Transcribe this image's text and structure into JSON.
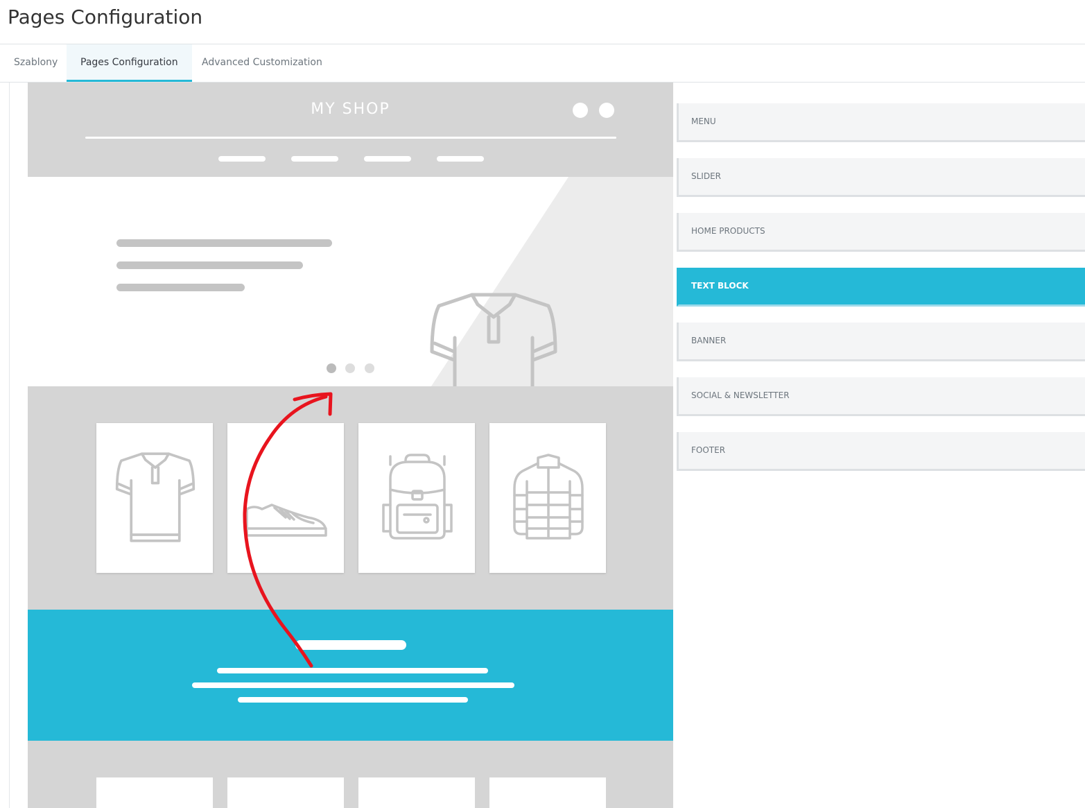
{
  "page": {
    "title": "Pages Configuration"
  },
  "tabs": [
    {
      "label": "Szablony",
      "active": false
    },
    {
      "label": "Pages Configuration",
      "active": true
    },
    {
      "label": "Advanced Customization",
      "active": false
    }
  ],
  "preview": {
    "shop_name": "MY SHOP",
    "slider": {
      "active_dot": 0,
      "dot_count": 3
    },
    "products": [
      "polo-shirt",
      "sneaker",
      "backpack",
      "jacket"
    ]
  },
  "sections": [
    {
      "label": "MENU",
      "active": false
    },
    {
      "label": "SLIDER",
      "active": false
    },
    {
      "label": "HOME PRODUCTS",
      "active": false
    },
    {
      "label": "TEXT BLOCK",
      "active": true
    },
    {
      "label": "BANNER",
      "active": false
    },
    {
      "label": "SOCIAL & NEWSLETTER",
      "active": false
    },
    {
      "label": "FOOTER",
      "active": false
    }
  ],
  "colors": {
    "accent": "#25b9d7",
    "annotation": "#e8141e",
    "preview_gray": "#d5d5d5"
  }
}
